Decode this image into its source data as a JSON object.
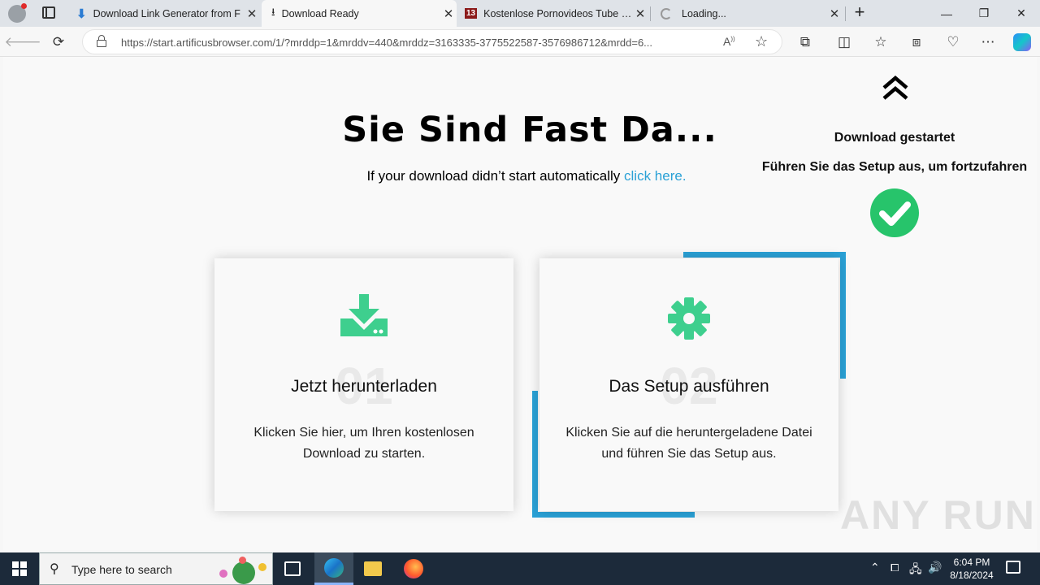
{
  "browser": {
    "tabs": [
      {
        "title": "Download Link Generator from F",
        "active": false
      },
      {
        "title": "Download Ready",
        "active": true
      },
      {
        "title": "Kostenlose Pornovideos Tube & C",
        "active": false
      },
      {
        "title": "Loading...",
        "active": false
      }
    ],
    "url": "https://start.artificusbrowser.com/1/?mrddp=1&mrddv=440&mrddz=3163335-3775522587-3576986712&mrdd=6...",
    "tab4_favicon_text": "13"
  },
  "page": {
    "headline": "Sie Sind Fast Da...",
    "subline_text": "If your download didn’t start automatically ",
    "subline_link": "click here.",
    "notice": {
      "title": "Download gestartet",
      "text": "Führen Sie das Setup aus, um fortzufahren"
    },
    "cards": [
      {
        "num": "01",
        "title": "Jetzt herunterladen",
        "text": "Klicken Sie hier, um Ihren kostenlosen Download zu starten.",
        "icon": "download-icon"
      },
      {
        "num": "02",
        "title": "Das Setup ausführen",
        "text": "Klicken Sie auf die heruntergeladene Datei und führen Sie das Setup aus.",
        "icon": "gear-icon"
      }
    ],
    "accent": "#2aa1d6",
    "icon_green": "#3ecf8e",
    "watermark": "ANY RUN"
  },
  "taskbar": {
    "search_placeholder": "Type here to search",
    "time": "6:04 PM",
    "date": "8/18/2024"
  }
}
